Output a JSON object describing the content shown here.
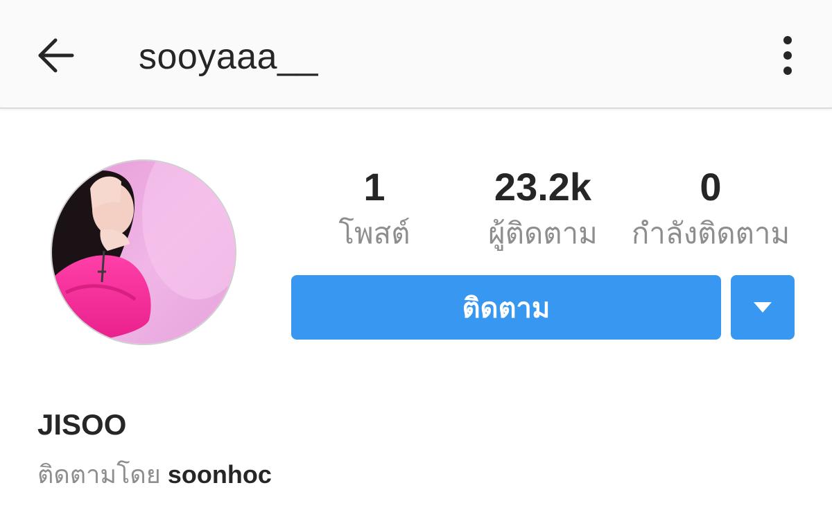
{
  "header": {
    "username": "sooyaaa__",
    "back_icon": "arrow-left-icon",
    "more_icon": "more-vertical-icon"
  },
  "profile": {
    "avatar_icon": "profile-photo",
    "stats": {
      "posts": {
        "value": "1",
        "label": "โพสต์"
      },
      "followers": {
        "value": "23.2k",
        "label": "ผู้ติดตาม"
      },
      "following": {
        "value": "0",
        "label": "กำลังติดตาม"
      }
    },
    "follow_label": "ติดตาม",
    "dropdown_icon": "caret-down-icon"
  },
  "bio": {
    "full_name": "JISOO",
    "followed_by_prefix": "ติดตามโดย",
    "followed_by_user": "soonhoc"
  },
  "colors": {
    "accent": "#3897f0",
    "text_primary": "#262626",
    "text_secondary": "#8e8e8e",
    "appbar_bg": "#fafafa"
  }
}
